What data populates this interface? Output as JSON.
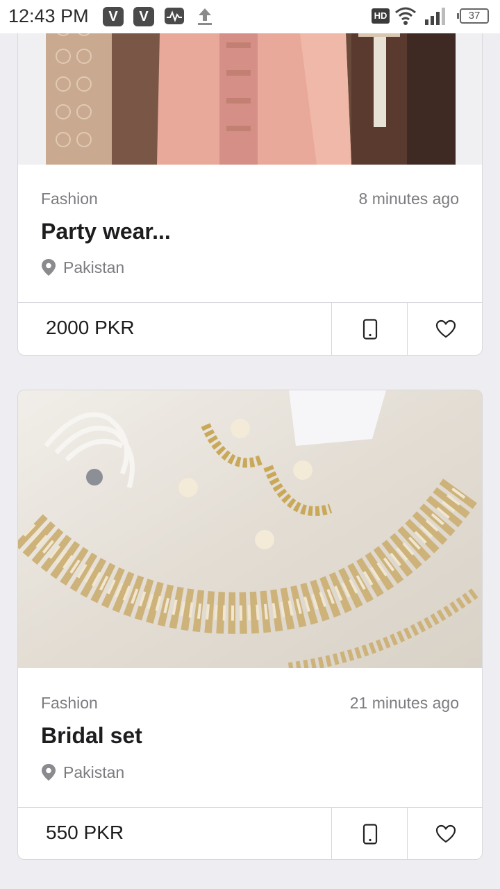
{
  "status_bar": {
    "time": "12:43 PM",
    "app1": "V",
    "app2": "V",
    "network_badge": "HD",
    "battery": "37"
  },
  "listings": [
    {
      "category": "Fashion",
      "time_ago": "8 minutes ago",
      "title": "Party wear...",
      "location": "Pakistan",
      "price": "2000 PKR"
    },
    {
      "category": "Fashion",
      "time_ago": "21 minutes ago",
      "title": "Bridal set",
      "location": "Pakistan",
      "price": "550 PKR"
    }
  ],
  "colors": {
    "background": "#eeeef2",
    "card": "#ffffff",
    "muted_text": "#7b7b80",
    "title_text": "#1d1d1f"
  }
}
